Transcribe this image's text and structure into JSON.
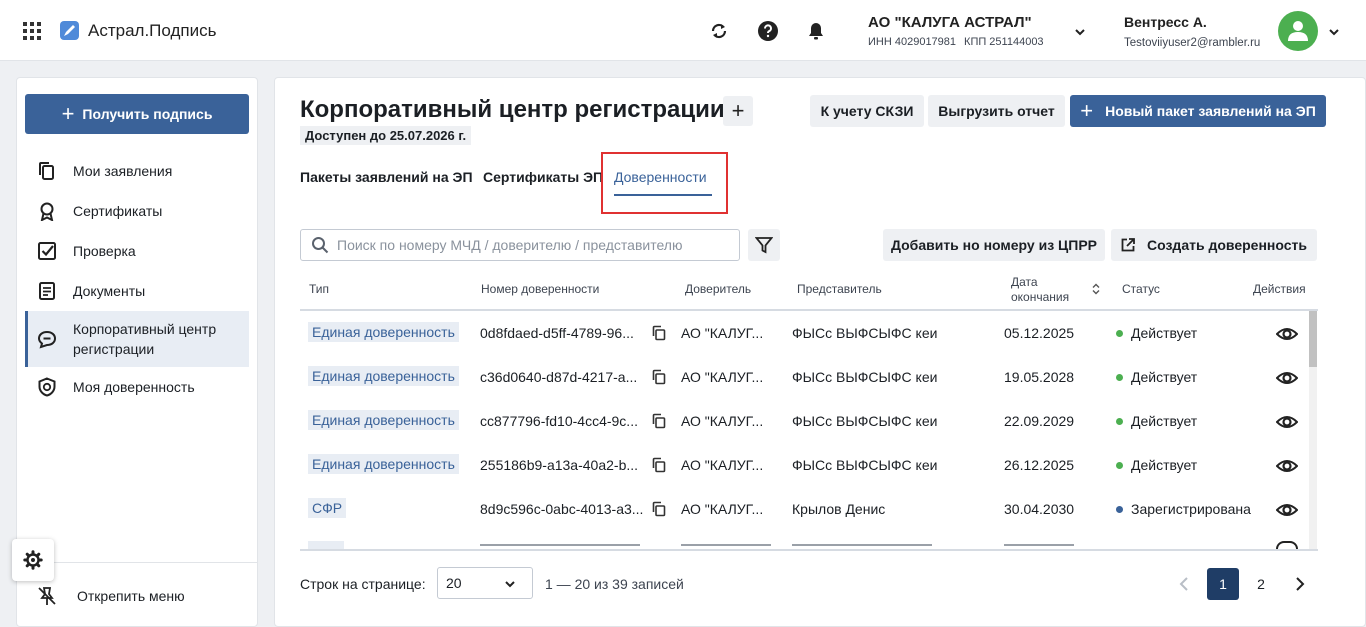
{
  "header": {
    "app_name": "Астрал.Подпись",
    "org_name": "АО \"КАЛУГА АСТРАЛ\"",
    "org_inn": "ИНН 4029017981",
    "org_kpp": "КПП 251144003",
    "user_name": "Вентресс А.",
    "user_email": "Testoviiyuser2@rambler.ru"
  },
  "sidebar": {
    "get_sign": "Получить подпись",
    "items": [
      {
        "label": "Мои заявления",
        "icon": "documents-copy-icon"
      },
      {
        "label": "Сертификаты",
        "icon": "award-ribbon-icon"
      },
      {
        "label": "Проверка",
        "icon": "checkbox-check-icon"
      },
      {
        "label": "Документы",
        "icon": "document-lines-icon"
      },
      {
        "label": "Корпоративный центр регистрации",
        "icon": "chat-bubble-icon",
        "active": true
      },
      {
        "label": "Моя доверенность",
        "icon": "shield-check-icon"
      }
    ],
    "unpin": "Открепить меню"
  },
  "main": {
    "title": "Корпоративный центр регистрации",
    "available_until": "Доступен до 25.07.2026 г.",
    "btn_skzi": "К учету СКЗИ",
    "btn_export": "Выгрузить отчет",
    "btn_new_package": "Новый пакет заявлений на ЭП",
    "tabs": [
      {
        "label": "Пакеты заявлений на ЭП"
      },
      {
        "label": "Сертификаты ЭП"
      },
      {
        "label": "Доверенности",
        "active": true
      }
    ],
    "search_placeholder": "Поиск по номеру МЧД / доверителю / представителю",
    "btn_add_by_number": "Добавить но номеру из ЦПРР",
    "btn_create": "Создать доверенность"
  },
  "table": {
    "columns": {
      "type": "Тип",
      "number": "Номер доверенности",
      "principal": "Доверитель",
      "representative": "Представитель",
      "end_date_line1": "Дата",
      "end_date_line2": "окончания",
      "status": "Статус",
      "actions": "Действия"
    },
    "rows": [
      {
        "type": "Единая доверенность",
        "number": "0d8fdaed-d5ff-4789-96...",
        "principal": "АО \"КАЛУГ...",
        "representative": "ФЫСс ВЫФСЫФС кеи",
        "end_date": "05.12.2025",
        "status": "Действует",
        "status_color": "#4caf50"
      },
      {
        "type": "Единая доверенность",
        "number": "c36d0640-d87d-4217-a...",
        "principal": "АО \"КАЛУГ...",
        "representative": "ФЫСс ВЫФСЫФС кеи",
        "end_date": "19.05.2028",
        "status": "Действует",
        "status_color": "#4caf50"
      },
      {
        "type": "Единая доверенность",
        "number": "cc877796-fd10-4cc4-9c...",
        "principal": "АО \"КАЛУГ...",
        "representative": "ФЫСс ВЫФСЫФС кеи",
        "end_date": "22.09.2029",
        "status": "Действует",
        "status_color": "#4caf50"
      },
      {
        "type": "Единая доверенность",
        "number": "255186b9-a13a-40a2-b...",
        "principal": "АО \"КАЛУГ...",
        "representative": "ФЫСс ВЫФСЫФС кеи",
        "end_date": "26.12.2025",
        "status": "Действует",
        "status_color": "#4caf50"
      },
      {
        "type": "СФР",
        "number": "8d9c596c-0abc-4013-a3...",
        "principal": "АО \"КАЛУГ...",
        "representative": "Крылов Денис",
        "end_date": "30.04.2030",
        "status": "Зарегистрирована",
        "status_color": "#3a6299"
      }
    ]
  },
  "pagination": {
    "rows_label": "Строк на странице:",
    "rows_value": "20",
    "info": "1 — 20 из 39 записей",
    "pages": [
      "1",
      "2"
    ]
  },
  "colors": {
    "accent": "#3a6299",
    "active_status": "#4caf50",
    "highlight": "#e03131"
  }
}
